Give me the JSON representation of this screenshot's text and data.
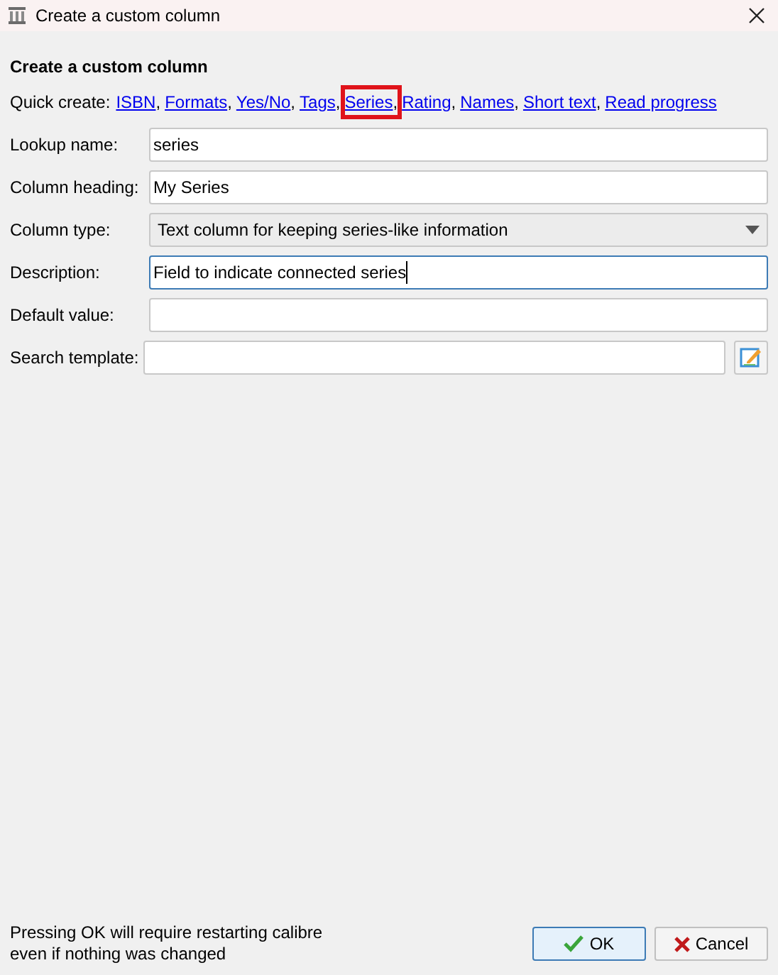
{
  "window": {
    "title": "Create a custom column"
  },
  "heading": "Create a custom column",
  "quick_create": {
    "label": "Quick create:",
    "separator": ",",
    "links": [
      {
        "label": "ISBN",
        "highlighted": false
      },
      {
        "label": "Formats",
        "highlighted": false
      },
      {
        "label": "Yes/No",
        "highlighted": false
      },
      {
        "label": "Tags",
        "highlighted": false
      },
      {
        "label": "Series",
        "highlighted": true
      },
      {
        "label": "Rating",
        "highlighted": false
      },
      {
        "label": "Names",
        "highlighted": false
      },
      {
        "label": "Short text",
        "highlighted": false
      },
      {
        "label": "Read progress",
        "highlighted": false
      }
    ]
  },
  "fields": [
    {
      "kind": "text",
      "label": "Lookup name:",
      "value": "series",
      "focused": false
    },
    {
      "kind": "text",
      "label": "Column heading:",
      "value": "My Series",
      "focused": false
    },
    {
      "kind": "select",
      "label": "Column type:",
      "value": "Text column for keeping series-like information",
      "focused": false
    },
    {
      "kind": "text",
      "label": "Description:",
      "value": "Field to indicate connected series",
      "focused": true
    },
    {
      "kind": "text",
      "label": "Default value:",
      "focused": false
    },
    {
      "kind": "template",
      "label": "Search template:",
      "focused": false
    }
  ],
  "footer_note": "Pressing OK will require restarting calibre even if nothing was changed",
  "buttons": [
    {
      "kind": "ok",
      "label": "OK"
    },
    {
      "kind": "cancel",
      "label": "Cancel"
    }
  ]
}
